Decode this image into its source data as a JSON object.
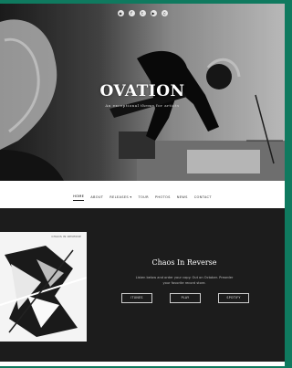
{
  "hero": {
    "site_title": "OVATION",
    "tagline": "An exceptional theme for artists",
    "social_icons": [
      "instagram-icon",
      "facebook-icon",
      "twitter-icon",
      "youtube-icon",
      "soundcloud-icon"
    ]
  },
  "nav": {
    "items": [
      {
        "label": "Home"
      },
      {
        "label": "About"
      },
      {
        "label": "Releases ▾"
      },
      {
        "label": "Tour"
      },
      {
        "label": "Photos"
      },
      {
        "label": "News"
      },
      {
        "label": "Contact"
      }
    ]
  },
  "featured": {
    "album_label": "CHAOS IN REVERSE",
    "title": "Chaos In Reverse",
    "desc_line1": "Listen below and order your copy. Out on October. Preorder",
    "desc_line2": "your favorite record store.",
    "buttons": [
      {
        "label": "iTunes"
      },
      {
        "label": "Play"
      },
      {
        "label": "Spotify"
      }
    ]
  },
  "colors": {
    "outer_background": "#0f7a5f",
    "featured_background": "#1c1c1c"
  }
}
